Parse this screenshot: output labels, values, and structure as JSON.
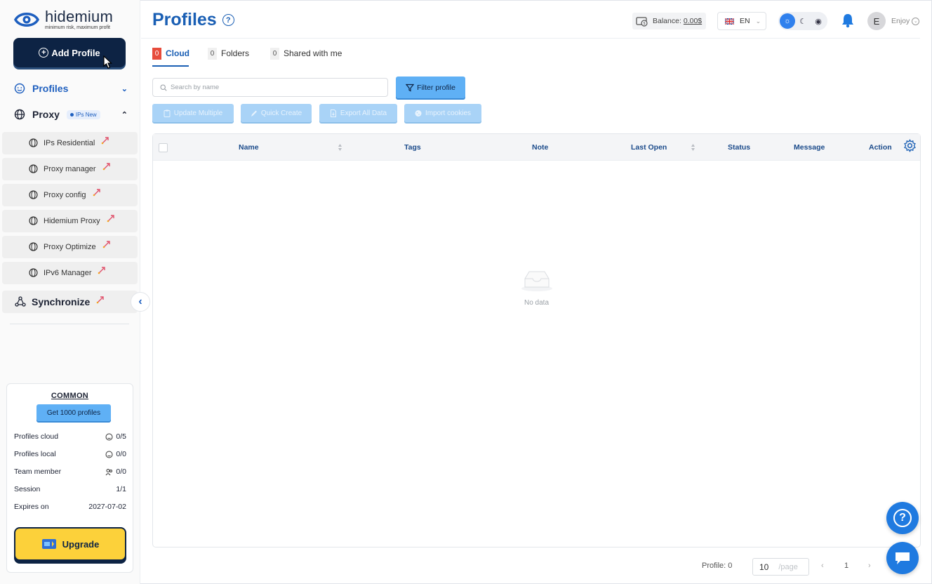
{
  "brand": {
    "name": "hidemium",
    "tagline": "minimum risk, maximum profit"
  },
  "sidebar": {
    "add_profile_label": "Add Profile",
    "profiles_label": "Profiles",
    "proxy_label": "Proxy",
    "proxy_badge": "IPs New",
    "proxy_items": [
      {
        "label": "IPs Residential"
      },
      {
        "label": "Proxy manager"
      },
      {
        "label": "Proxy config"
      },
      {
        "label": "Hidemium Proxy"
      },
      {
        "label": "Proxy Optimize"
      },
      {
        "label": "IPv6 Manager"
      }
    ],
    "synchronize_label": "Synchronize"
  },
  "plan": {
    "title": "COMMON",
    "cta": "Get 1000 profiles",
    "rows": [
      {
        "label": "Profiles cloud",
        "value": "0/5"
      },
      {
        "label": "Profiles local",
        "value": "0/0"
      },
      {
        "label": "Team member",
        "value": "0/0"
      },
      {
        "label": "Session",
        "value": "1/1"
      },
      {
        "label": "Expires on",
        "value": "2027-07-02"
      }
    ],
    "upgrade_label": "Upgrade"
  },
  "header": {
    "title": "Profiles",
    "balance_label": "Balance:",
    "balance_value": "0.00$",
    "language": "EN",
    "user_initial": "E",
    "user_name": "Enjoy"
  },
  "tabs": [
    {
      "count": "0",
      "label": "Cloud",
      "active": true
    },
    {
      "count": "0",
      "label": "Folders"
    },
    {
      "count": "0",
      "label": "Shared with me"
    }
  ],
  "toolbar": {
    "search_placeholder": "Search by name",
    "filter_label": "Filter profile",
    "actions": [
      "Update Multiple",
      "Quick Create",
      "Export All Data",
      "Import cookies"
    ]
  },
  "table": {
    "columns": [
      "Name",
      "Tags",
      "Note",
      "Last Open",
      "Status",
      "Message",
      "Action"
    ],
    "empty_text": "No data"
  },
  "pagination": {
    "profile_count": "Profile: 0",
    "page_size": "10",
    "page_suffix": "/page",
    "current_page": "1"
  },
  "colors": {
    "primary": "#1a5fb4",
    "navy": "#0d2344",
    "accent_light": "#5fb0f5",
    "upgrade": "#fcd13a",
    "tab_badge": "#e74c3c"
  }
}
